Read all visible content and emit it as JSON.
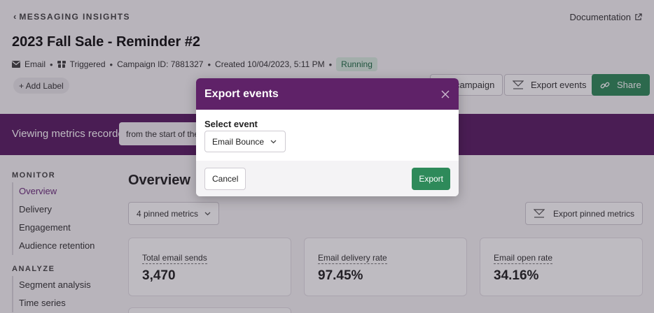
{
  "header": {
    "back_label": "MESSAGING INSIGHTS",
    "docs_label": "Documentation",
    "title": "2023 Fall Sale - Reminder #2",
    "meta": {
      "channel": "Email",
      "trigger": "Triggered",
      "campaign_id": "Campaign ID: 7881327",
      "created": "Created 10/04/2023, 5:11 PM",
      "status": "Running"
    },
    "add_label": "+ Add Label",
    "buttons": {
      "campaign": "campaign",
      "export_events": "Export events",
      "share": "Share"
    }
  },
  "band": {
    "label": "Viewing metrics recorded",
    "select_value": "from the start of the"
  },
  "sidebar": {
    "sections": [
      {
        "title": "MONITOR",
        "items": [
          "Overview",
          "Delivery",
          "Engagement",
          "Audience retention"
        ]
      },
      {
        "title": "ANALYZE",
        "items": [
          "Segment analysis",
          "Time series"
        ]
      }
    ]
  },
  "main": {
    "title": "Overview",
    "pinned_select": "4 pinned metrics",
    "export_pinned": "Export pinned metrics",
    "cards": [
      {
        "label": "Total email sends",
        "value": "3,470"
      },
      {
        "label": "Email delivery rate",
        "value": "97.45%"
      },
      {
        "label": "Email open rate",
        "value": "34.16%"
      }
    ]
  },
  "modal": {
    "title": "Export events",
    "field_label": "Select event",
    "select_value": "Email Bounce",
    "cancel": "Cancel",
    "export": "Export"
  },
  "colors": {
    "brand_purple": "#5f2268",
    "accent_green": "#2e8a5a",
    "running_badge_bg": "#d8ece0"
  }
}
